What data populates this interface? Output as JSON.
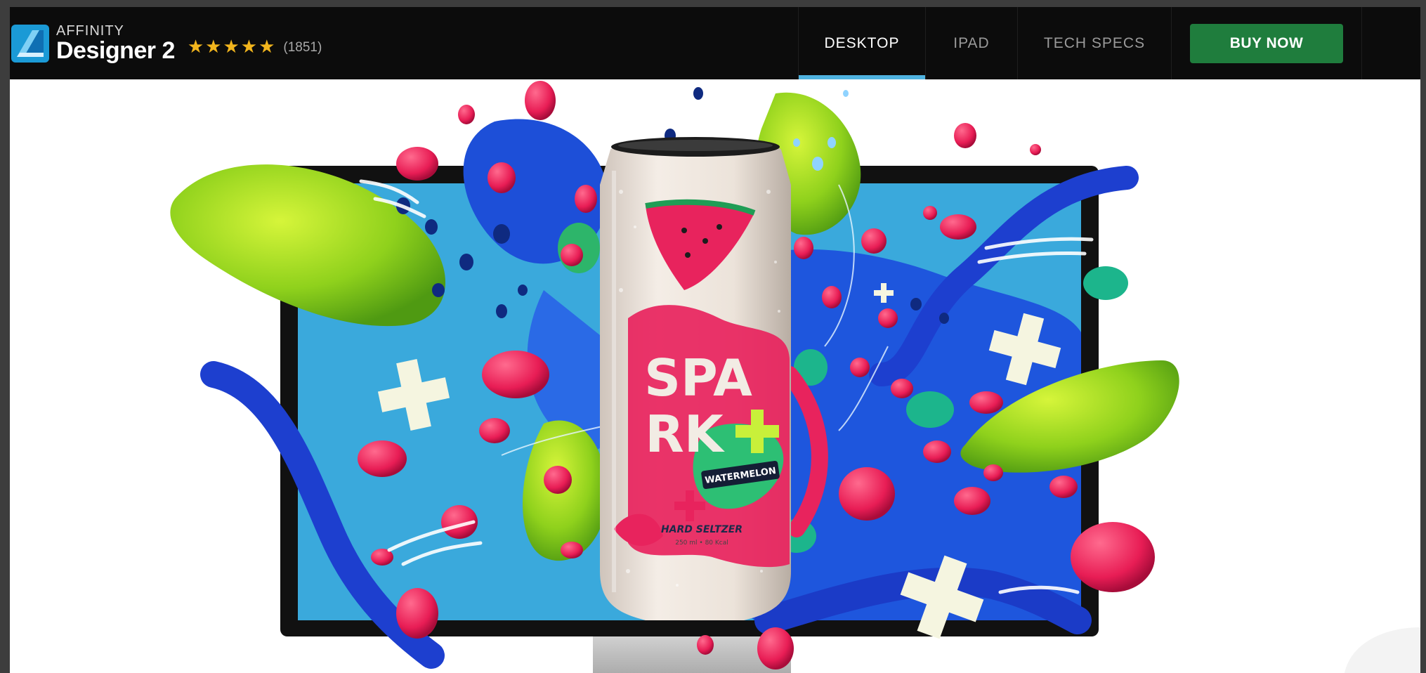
{
  "brand": {
    "small": "AFFINITY",
    "name": "Designer 2",
    "stars": "★★★★★",
    "rating_count": "(1851)"
  },
  "nav": {
    "items": [
      "DESKTOP",
      "IPAD",
      "TECH SPECS"
    ],
    "active": "DESKTOP",
    "buy_label": "BUY NOW"
  },
  "colors": {
    "navbar_bg": "#0c0c0c",
    "accent_underline": "#4fb3e0",
    "buy_button": "#1f7d3d",
    "stars": "#f2b51d"
  },
  "hero": {
    "can": {
      "brand_line1": "SPA",
      "brand_line2": "RK",
      "flavor": "WATERMELON",
      "product": "HARD SELTZER",
      "volume": "250 ml • 80 Kcal"
    }
  }
}
